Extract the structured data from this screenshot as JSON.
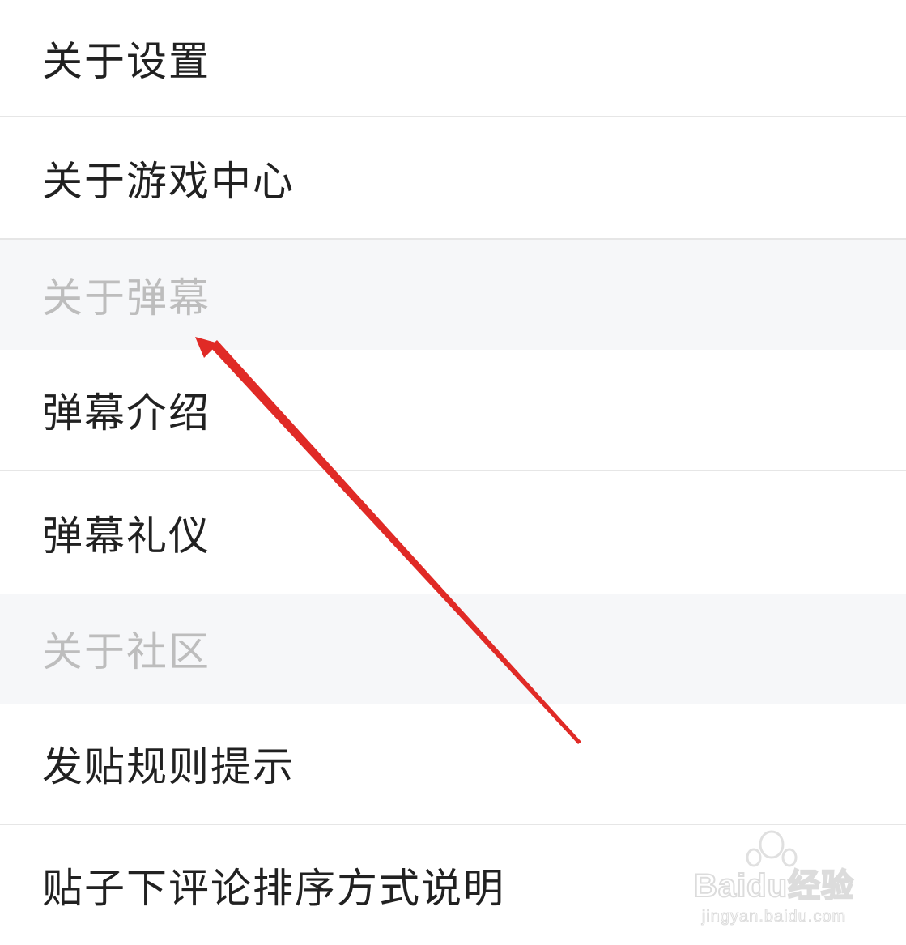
{
  "menu": {
    "items": [
      {
        "label": "关于设置"
      },
      {
        "label": "关于游戏中心"
      }
    ],
    "sections": [
      {
        "header": "关于弹幕",
        "items": [
          {
            "label": "弹幕介绍"
          },
          {
            "label": "弹幕礼仪"
          }
        ]
      },
      {
        "header": "关于社区",
        "items": [
          {
            "label": "发贴规则提示"
          },
          {
            "label": "贴子下评论排序方式说明"
          }
        ]
      }
    ]
  },
  "annotation": {
    "arrow_color": "#e02a26"
  },
  "watermark": {
    "brand": "Baidu经验",
    "url": "jingyan.baidu.com"
  }
}
